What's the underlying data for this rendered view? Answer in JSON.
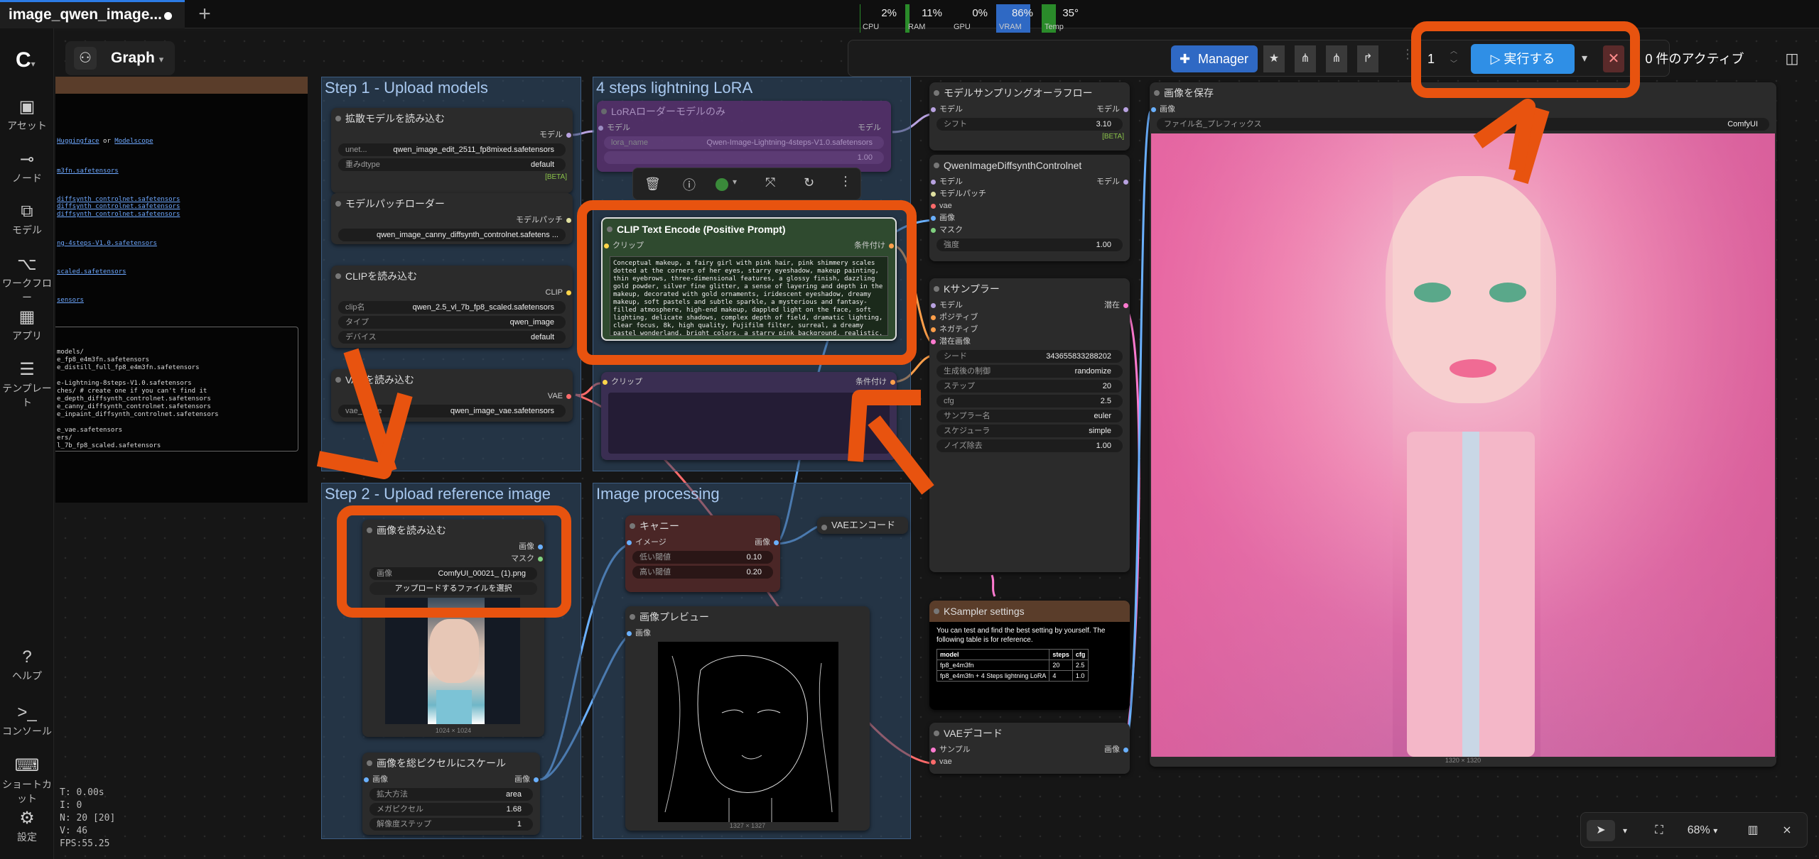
{
  "tab": {
    "title": "image_qwen_image..."
  },
  "sidebar": {
    "items": [
      {
        "label": "アセット",
        "icon": "assets-icon"
      },
      {
        "label": "ノード",
        "icon": "node-icon"
      },
      {
        "label": "モデル",
        "icon": "model-icon"
      },
      {
        "label": "ワークフロー",
        "icon": "workflow-icon"
      },
      {
        "label": "アプリ",
        "icon": "app-icon"
      },
      {
        "label": "テンプレート",
        "icon": "template-icon"
      },
      {
        "label": "ヘルプ",
        "icon": "help-icon"
      },
      {
        "label": "コンソール",
        "icon": "console-icon"
      },
      {
        "label": "ショートカット",
        "icon": "keyboard-icon"
      },
      {
        "label": "設定",
        "icon": "settings-icon"
      }
    ]
  },
  "graph_button": {
    "label": "Graph"
  },
  "toolbar": {
    "stats": [
      {
        "name": "CPU",
        "value": "2%",
        "level": 0.02
      },
      {
        "name": "RAM",
        "value": "11%",
        "level": 0.11
      },
      {
        "name": "GPU",
        "value": "0%",
        "level": 0
      },
      {
        "name": "VRAM",
        "value": "86%",
        "level": 0.86
      },
      {
        "name": "Temp",
        "value": "35°",
        "level": 0.35
      }
    ],
    "manager": "Manager",
    "queue_count": "1",
    "run": "実行する",
    "active": "0 件のアクティブ"
  },
  "groups": {
    "step1": "Step 1 - Upload models",
    "lora": "4 steps lightning LoRA",
    "step2": "Step 2 - Upload reference image",
    "imgproc": "Image processing"
  },
  "nodes": {
    "diffusion": {
      "title": "拡散モデルを読み込む",
      "out": "モデル",
      "w1l": "unet...",
      "w1v": "qwen_image_edit_2511_fp8mixed.safetensors",
      "w2l": "重みdtype",
      "w2v": "default",
      "badge": "[BETA]"
    },
    "patch": {
      "title": "モデルパッチローダー",
      "out": "モデルパッチ",
      "w1v": "qwen_image_canny_diffsynth_controlnet.safetens ..."
    },
    "clip": {
      "title": "CLIPを読み込む",
      "out": "CLIP",
      "w1l": "clip名",
      "w1v": "qwen_2.5_vl_7b_fp8_scaled.safetensors",
      "w2l": "タイプ",
      "w2v": "qwen_image",
      "w3l": "デバイス",
      "w3v": "default"
    },
    "vae": {
      "title": "VAEを読み込む",
      "out": "VAE",
      "w1l": "vae_name",
      "w1v": "qwen_image_vae.safetensors"
    },
    "lora": {
      "title": "LoRAローダーモデルのみ",
      "in": "モデル",
      "out": "モデル",
      "w1l": "lora_name",
      "w1v": "Qwen-Image-Lightning-4steps-V1.0.safetensors",
      "w2v": "1.00"
    },
    "clip_pos": {
      "title": "CLIP Text Encode (Positive Prompt)",
      "in": "クリップ",
      "out": "条件付け",
      "text": "Conceptual makeup, a fairy girl with pink hair, pink shimmery scales dotted at the corners of her eyes, starry eyeshadow, makeup painting, thin eyebrows, three-dimensional features, a glossy finish, dazzling gold powder, silver fine glitter, a sense of layering and depth in the makeup, decorated with gold ornaments, iridescent eyeshadow, dreamy makeup, soft pastels and subtle sparkle, a mysterious and fantasy-filled atmosphere, high-end makeup, dappled light on the face, soft lighting, delicate shadows, complex depth of field, dramatic lighting, clear focus, 8k, high quality, Fujifilm filter, surreal, a dreamy pastel wonderland, bright colors, a starry pink background, realistic."
    },
    "clip_neg": {
      "in": "クリップ",
      "out": "条件付け"
    },
    "load_image": {
      "title": "画像を読み込む",
      "out1": "画像",
      "out2": "マスク",
      "w1l": "画像",
      "w1v": "ComfyUI_00021_ (1).png",
      "upload": "アップロードするファイルを選択",
      "dims": "1024 × 1024"
    },
    "scale": {
      "title": "画像を総ピクセルにスケール",
      "in": "画像",
      "out": "画像",
      "w1l": "拡大方法",
      "w1v": "area",
      "w2l": "メガピクセル",
      "w2v": "1.68",
      "w3l": "解像度ステップ",
      "w3v": "1"
    },
    "canny": {
      "title": "キャニー",
      "in": "イメージ",
      "out": "画像",
      "w1l": "低い閾値",
      "w1v": "0.10",
      "w2l": "高い閾値",
      "w2v": "0.20"
    },
    "preview": {
      "title": "画像プレビュー",
      "in": "画像",
      "dims": "1327 × 1327"
    },
    "vae_encode": {
      "title": "VAEエンコード"
    },
    "sampling": {
      "title": "モデルサンプリングオーラフロー",
      "in": "モデル",
      "out": "モデル",
      "w1l": "シフト",
      "w1v": "3.10",
      "badge": "[BETA]"
    },
    "controlnet": {
      "title": "QwenImageDiffsynthControlnet",
      "in1": "モデル",
      "in2": "モデルパッチ",
      "in3": "vae",
      "in4": "画像",
      "in5": "マスク",
      "out": "モデル",
      "w1l": "強度",
      "w1v": "1.00"
    },
    "ksampler": {
      "title": "Kサンプラー",
      "in1": "モデル",
      "in2": "ポジティブ",
      "in3": "ネガティブ",
      "in4": "潜在画像",
      "out": "潜在",
      "w1l": "シード",
      "w1v": "343655833288202",
      "w2l": "生成後の制御",
      "w2v": "randomize",
      "w3l": "ステップ",
      "w3v": "20",
      "w4l": "cfg",
      "w4v": "2.5",
      "w5l": "サンプラー名",
      "w5v": "euler",
      "w6l": "スケジューラ",
      "w6v": "simple",
      "w7l": "ノイズ除去",
      "w7v": "1.00"
    },
    "ksettings": {
      "title": "KSampler settings",
      "text": "You can test and find the best setting by yourself. The following table is for reference.",
      "headers": [
        "model",
        "steps",
        "cfg"
      ],
      "rows": [
        [
          "fp8_e4m3fn",
          "20",
          "2.5"
        ],
        [
          "fp8_e4m3fn + 4 Steps lightning LoRA",
          "4",
          "1.0"
        ]
      ]
    },
    "vae_decode": {
      "title": "VAEデコード",
      "in1": "サンプル",
      "in2": "vae",
      "out": "画像"
    },
    "save": {
      "title": "画像を保存",
      "in": "画像",
      "w1l": "ファイル名_プレフィックス",
      "w1v": "ComfyUI",
      "dims": "1320 × 1320"
    }
  },
  "left_panel": {
    "lines": [
      {
        "t": "Huggingface",
        "link": true,
        "prefix": "",
        "suffix": " or ",
        "extra": "Modelscope"
      },
      {
        "t": "m3fn.safetensors",
        "link": true
      },
      {
        "t": "diffsynth_controlnet.safetensors",
        "link": true
      },
      {
        "t": "diffsynth_controlnet.safetensors",
        "link": true
      },
      {
        "t": "diffsynth_controlnet.safetensors",
        "link": true
      },
      {
        "t": "ng-4steps-V1.0.safetensors",
        "link": true
      },
      {
        "t": "scaled.safetensors",
        "link": true
      },
      {
        "t": "sensors",
        "link": true
      }
    ],
    "code": [
      "models/",
      "e_fp8_e4m3fn.safetensors",
      "e_distill_full_fp8_e4m3fn.safetensors",
      "",
      "e-Lightning-8steps-V1.0.safetensors",
      "ches/ # create one if you can't find it",
      "e_depth_diffsynth_controlnet.safetensors",
      "e_canny_diffsynth_controlnet.safetensors",
      "e_inpaint_diffsynth_controlnet.safetensors",
      "",
      "e_vae.safetensors",
      "ers/",
      "l_7b_fp8_scaled.safetensors"
    ]
  },
  "stats_overlay": {
    "t": "T: 0.00s",
    "i": "I: 0",
    "n": "N: 20 [20]",
    "v": "V: 46",
    "fps": "FPS:55.25"
  },
  "zoom": {
    "value": "68%"
  }
}
